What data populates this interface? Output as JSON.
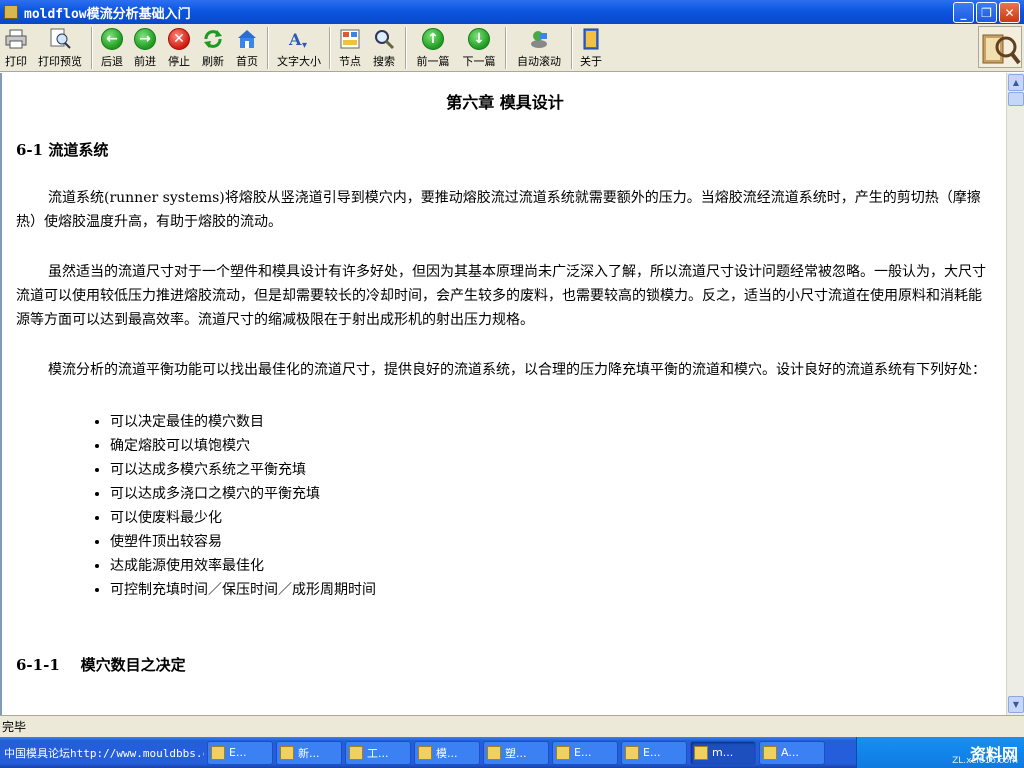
{
  "window": {
    "title": "moldflow模流分析基础入门"
  },
  "toolbar": {
    "buttons": [
      {
        "label": "打印"
      },
      {
        "label": "打印预览"
      },
      {
        "label": "后退"
      },
      {
        "label": "前进"
      },
      {
        "label": "停止"
      },
      {
        "label": "刷新"
      },
      {
        "label": "首页"
      },
      {
        "label": "文字大小"
      },
      {
        "label": "节点"
      },
      {
        "label": "搜索"
      },
      {
        "label": "前一篇"
      },
      {
        "label": "下一篇"
      },
      {
        "label": "自动滚动"
      },
      {
        "label": "关于"
      }
    ]
  },
  "document": {
    "chapter_title": "第六章  模具设计",
    "section_title": "6-1  流道系统",
    "paragraphs": [
      "流道系统(runner systems)将熔胶从竖浇道引导到模穴内，要推动熔胶流过流道系统就需要额外的压力。当熔胶流经流道系统时，产生的剪切热（摩擦热）使熔胶温度升高，有助于熔胶的流动。",
      "虽然适当的流道尺寸对于一个塑件和模具设计有许多好处，但因为其基本原理尚未广泛深入了解，所以流道尺寸设计问题经常被忽略。一般认为，大尺寸流道可以使用较低压力推进熔胶流动，但是却需要较长的冷却时间，会产生较多的废料，也需要较高的锁模力。反之，适当的小尺寸流道在使用原料和消耗能源等方面可以达到最高效率。流道尺寸的缩减极限在于射出成形机的射出压力规格。",
      "模流分析的流道平衡功能可以找出最佳化的流道尺寸，提供良好的流道系统，以合理的压力降充填平衡的流道和模穴。设计良好的流道系统有下列好处："
    ],
    "bullets": [
      "可以决定最佳的模穴数目",
      "确定熔胶可以填饱模穴",
      "可以达成多模穴系统之平衡充填",
      "可以达成多浇口之模穴的平衡充填",
      "可以使废料最少化",
      "使塑件顶出较容易",
      "达成能源使用效率最佳化",
      "可控制充填时间／保压时间／成形周期时间"
    ],
    "subsection_title": "6-1-1    模穴数目之决定"
  },
  "statusbar": {
    "text": "完毕"
  },
  "taskbar": {
    "url_text": "中国模具论坛http://www.mouldbbs.com",
    "tasks": [
      {
        "label": "E..."
      },
      {
        "label": "新..."
      },
      {
        "label": "工..."
      },
      {
        "label": "模..."
      },
      {
        "label": "塑..."
      },
      {
        "label": "E..."
      },
      {
        "label": "E..."
      },
      {
        "label": "m..."
      },
      {
        "label": "A..."
      }
    ],
    "tray_watermark": "资料网",
    "tray_sub": "ZL.xcl616.com"
  }
}
